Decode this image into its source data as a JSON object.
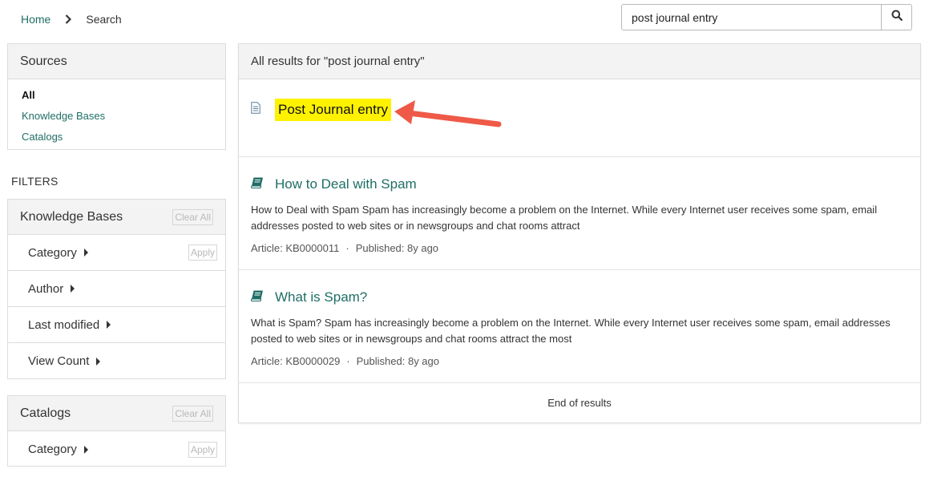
{
  "breadcrumb": {
    "home": "Home",
    "current": "Search"
  },
  "search": {
    "value": "post journal entry",
    "icon": "search-icon"
  },
  "sources": {
    "title": "Sources",
    "items": [
      {
        "label": "All",
        "active": true
      },
      {
        "label": "Knowledge Bases",
        "active": false
      },
      {
        "label": "Catalogs",
        "active": false
      }
    ]
  },
  "filters": {
    "title": "FILTERS",
    "knowledge_bases": {
      "title": "Knowledge Bases",
      "clear": "Clear All",
      "rows": [
        {
          "label": "Category",
          "apply": "Apply"
        },
        {
          "label": "Author"
        },
        {
          "label": "Last modified"
        },
        {
          "label": "View Count"
        }
      ]
    },
    "catalogs": {
      "title": "Catalogs",
      "clear": "Clear All",
      "rows": [
        {
          "label": "Category",
          "apply": "Apply"
        }
      ]
    }
  },
  "results": {
    "header": "All results for \"post journal entry\"",
    "items": [
      {
        "title": "Post Journal entry",
        "icon": "document-icon",
        "highlighted": true
      },
      {
        "title": "How to Deal with Spam",
        "icon": "book-icon",
        "description": "How to Deal with Spam Spam has increasingly become a problem on the Internet. While every Internet user receives some spam, email addresses posted to web sites or in newsgroups and chat rooms attract",
        "article": "Article: KB0000011",
        "published": "Published: 8y ago"
      },
      {
        "title": "What is Spam?",
        "icon": "book-icon",
        "description": "What is Spam? Spam has increasingly become a problem on the Internet. While every Internet user receives some spam, email addresses posted to web sites or in newsgroups and chat rooms attract the most",
        "article": "Article: KB0000029",
        "published": "Published: 8y ago"
      }
    ],
    "end": "End of results"
  },
  "colors": {
    "link": "#1f6e66",
    "highlight": "#fff200",
    "arrow": "#ef5a48"
  }
}
